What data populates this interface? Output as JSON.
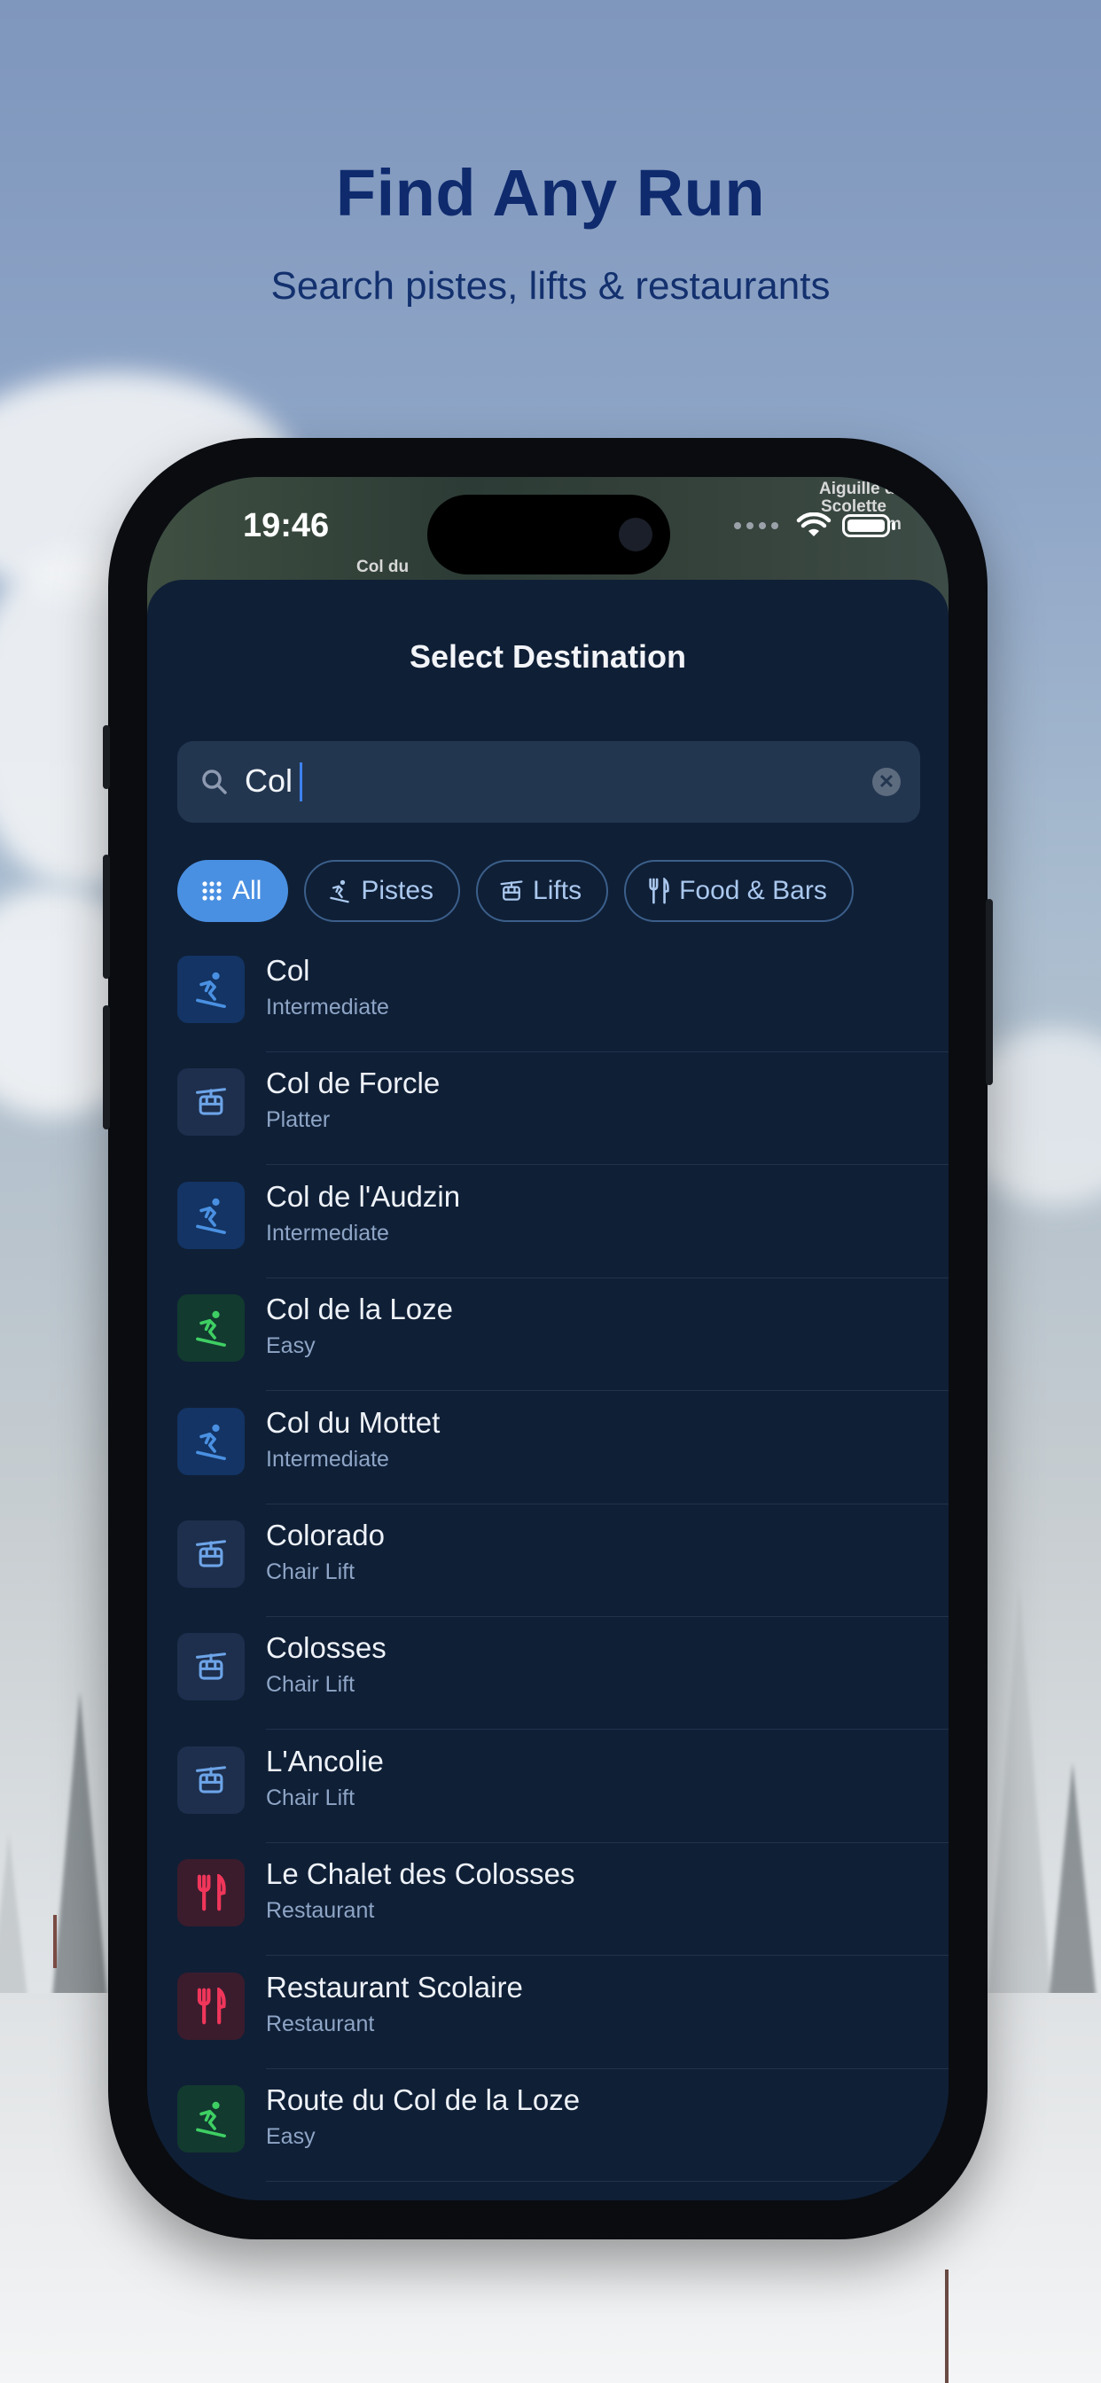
{
  "headline": "Find Any Run",
  "subheadline": "Search pistes, lifts & restaurants",
  "status_bar": {
    "time": "19:46"
  },
  "map_labels": [
    "Aiguille d",
    "Scolette",
    "m",
    "Col du"
  ],
  "sheet": {
    "title": "Select Destination",
    "search": {
      "value": "Col"
    },
    "filters": [
      {
        "label": "All",
        "icon": "grid-icon",
        "active": true
      },
      {
        "label": "Pistes",
        "icon": "skier-icon",
        "active": false
      },
      {
        "label": "Lifts",
        "icon": "cable-car-icon",
        "active": false
      },
      {
        "label": "Food & Bars",
        "icon": "fork-knife-icon",
        "active": false
      }
    ],
    "results": [
      {
        "name": "Col",
        "subtitle": "Intermediate",
        "icon": "skier-icon",
        "icon_color": "#4a90e2"
      },
      {
        "name": "Col de Forcle",
        "subtitle": "Platter",
        "icon": "cable-car-icon",
        "icon_color": "#6da4e8"
      },
      {
        "name": "Col de l'Audzin",
        "subtitle": "Intermediate",
        "icon": "skier-icon",
        "icon_color": "#4a90e2"
      },
      {
        "name": "Col de la Loze",
        "subtitle": "Easy",
        "icon": "skier-icon",
        "icon_color": "#3ecf63"
      },
      {
        "name": "Col du Mottet",
        "subtitle": "Intermediate",
        "icon": "skier-icon",
        "icon_color": "#4a90e2"
      },
      {
        "name": "Colorado",
        "subtitle": "Chair Lift",
        "icon": "cable-car-icon",
        "icon_color": "#6da4e8"
      },
      {
        "name": "Colosses",
        "subtitle": "Chair Lift",
        "icon": "cable-car-icon",
        "icon_color": "#6da4e8"
      },
      {
        "name": "L'Ancolie",
        "subtitle": "Chair Lift",
        "icon": "cable-car-icon",
        "icon_color": "#6da4e8"
      },
      {
        "name": "Le Chalet des Colosses",
        "subtitle": "Restaurant",
        "icon": "fork-knife-icon",
        "icon_color": "#f0365a"
      },
      {
        "name": "Restaurant Scolaire",
        "subtitle": "Restaurant",
        "icon": "fork-knife-icon",
        "icon_color": "#f0365a"
      },
      {
        "name": "Route du Col de la Loze",
        "subtitle": "Easy",
        "icon": "skier-icon",
        "icon_color": "#3ecf63"
      }
    ]
  }
}
